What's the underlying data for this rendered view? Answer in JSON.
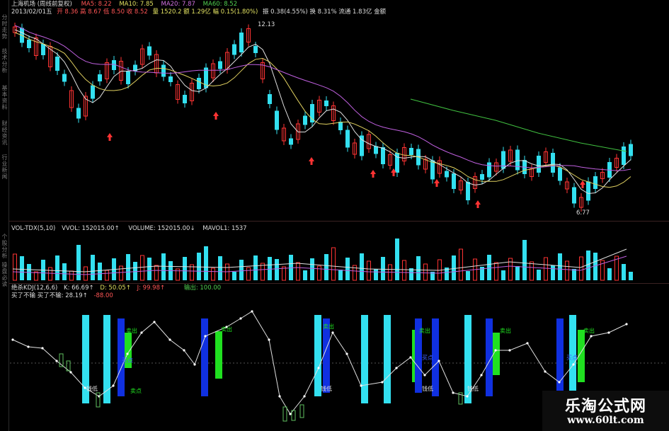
{
  "sidebar": {
    "tabs": [
      "分时走势",
      "技术分析",
      "基本资料",
      "财经资讯",
      "行业新闻",
      "个股分析",
      "操盘必读"
    ]
  },
  "price_panel": {
    "stock_name": "上海机场",
    "mode": "(周线前复权)",
    "date": "2013/02/01五",
    "open_line": "开 8.36 高 8.67 低 8.50 收 8.52",
    "vol_line": "量 1520.2 额 1.29亿 幅 0.15(1.80%)",
    "amp_line": "振 0.38(4.55%) 换 8.31% 流通 1.83亿 金额",
    "ma5": "MA5: 8.22",
    "ma10": "MA10: 7.85",
    "ma20": "MA20: 7.87",
    "ma60": "MA60: 8.52",
    "high_label": "12.13",
    "low_label": "6.77"
  },
  "volume_panel": {
    "indicator": "VOL-TDX(5,10)",
    "vvol": "VVOL: 152015.00↑",
    "volume": "VOLUME: 152015.00↓",
    "mavol1": "MAVOL1: 1537"
  },
  "kdj_panel": {
    "indicator": "绝杀KDJ(12,6,6)",
    "k": "K: 66.69↑",
    "d": "D: 50.05↑",
    "j": "J: 99.98↑",
    "buy": "输出: 100.00",
    "line2_a": "买了不输 买了不输: 28.19↑",
    "line2_b": "-88.00",
    "markers": [
      "卖出",
      "买点",
      "钱低",
      "卖点"
    ]
  },
  "watermark": {
    "title": "乐淘公式网",
    "url": "www.60lt.com"
  },
  "colors": {
    "up": "#ff3333",
    "down": "#33e0f0",
    "ma5": "#e0e0e0",
    "ma10": "#e0d060",
    "ma20": "#c060e0",
    "ma60": "#40c040"
  }
}
